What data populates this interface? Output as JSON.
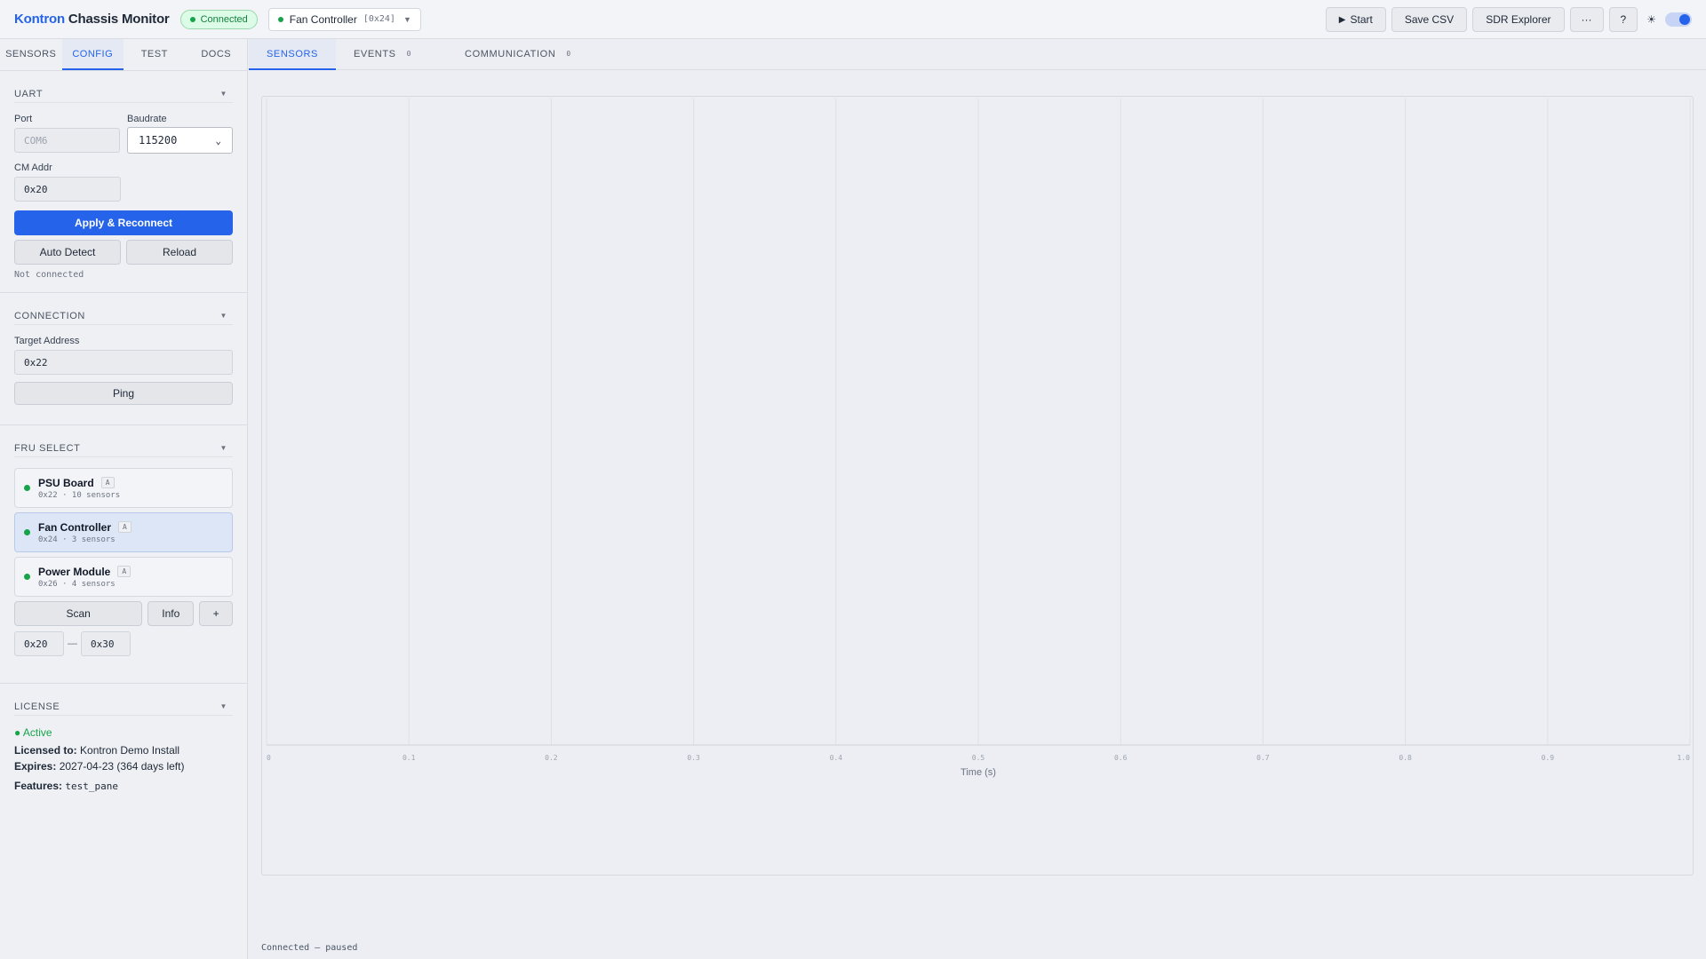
{
  "header": {
    "brand_accent": "Kontron",
    "brand_rest": " Chassis Monitor",
    "connection_status": "Connected",
    "fru_picker": {
      "name": "Fan Controller",
      "addr": "[0x24]"
    },
    "buttons": {
      "start": "Start",
      "save_csv": "Save CSV",
      "sdr_explorer": "SDR Explorer",
      "more": "···",
      "help": "?"
    },
    "theme_icon": "☀"
  },
  "sidebar": {
    "tabs": [
      {
        "label": "SENSORS"
      },
      {
        "label": "CONFIG"
      },
      {
        "label": "TEST"
      },
      {
        "label": "DOCS"
      }
    ],
    "active_tab": "CONFIG",
    "uart": {
      "title": "UART",
      "port_label": "Port",
      "port_placeholder": "COM6",
      "baud_label": "Baudrate",
      "baud_value": "115200",
      "cm_addr_label": "CM Addr",
      "cm_addr_value": "0x20",
      "apply_button": "Apply & Reconnect",
      "auto_detect_button": "Auto Detect",
      "reload_button": "Reload",
      "status": "Not connected"
    },
    "connection": {
      "title": "CONNECTION",
      "target_label": "Target Address",
      "target_value": "0x22",
      "ping_button": "Ping"
    },
    "fru_select": {
      "title": "FRU SELECT",
      "items": [
        {
          "name": "PSU Board",
          "tag": "A",
          "sub": "0x22 · 10 sensors"
        },
        {
          "name": "Fan Controller",
          "tag": "A",
          "sub": "0x24 · 3 sensors"
        },
        {
          "name": "Power Module",
          "tag": "A",
          "sub": "0x26 · 4 sensors"
        }
      ],
      "scan_button": "Scan",
      "info_button": "Info",
      "add_button": "+",
      "range_start": "0x20",
      "range_sep": "—",
      "range_end": "0x30"
    },
    "license": {
      "title": "LICENSE",
      "status": "● Active",
      "licensed_to_label": "Licensed to:",
      "licensed_to_value": " Kontron Demo Install",
      "expires_label": "Expires:",
      "expires_value": " 2027-04-23 (364 days left)",
      "features_label": "Features:",
      "features_value": "test_pane"
    }
  },
  "main": {
    "tabs": [
      {
        "label": "SENSORS",
        "count": ""
      },
      {
        "label": "EVENTS",
        "count": "0"
      },
      {
        "label": "COMMUNICATION",
        "count": "0"
      }
    ],
    "status": "Connected — paused"
  },
  "colors": {
    "accent": "#2563eb",
    "ok": "#16a34a"
  },
  "chart_data": {
    "type": "line",
    "xlabel": "Time (s)",
    "ylabel": "",
    "x_ticks": [
      "0",
      "0.1",
      "0.2",
      "0.3",
      "0.4",
      "0.5",
      "0.6",
      "0.7",
      "0.8",
      "0.9",
      "1.0"
    ],
    "xlim": [
      0,
      1.0
    ],
    "grid": true,
    "series": []
  }
}
